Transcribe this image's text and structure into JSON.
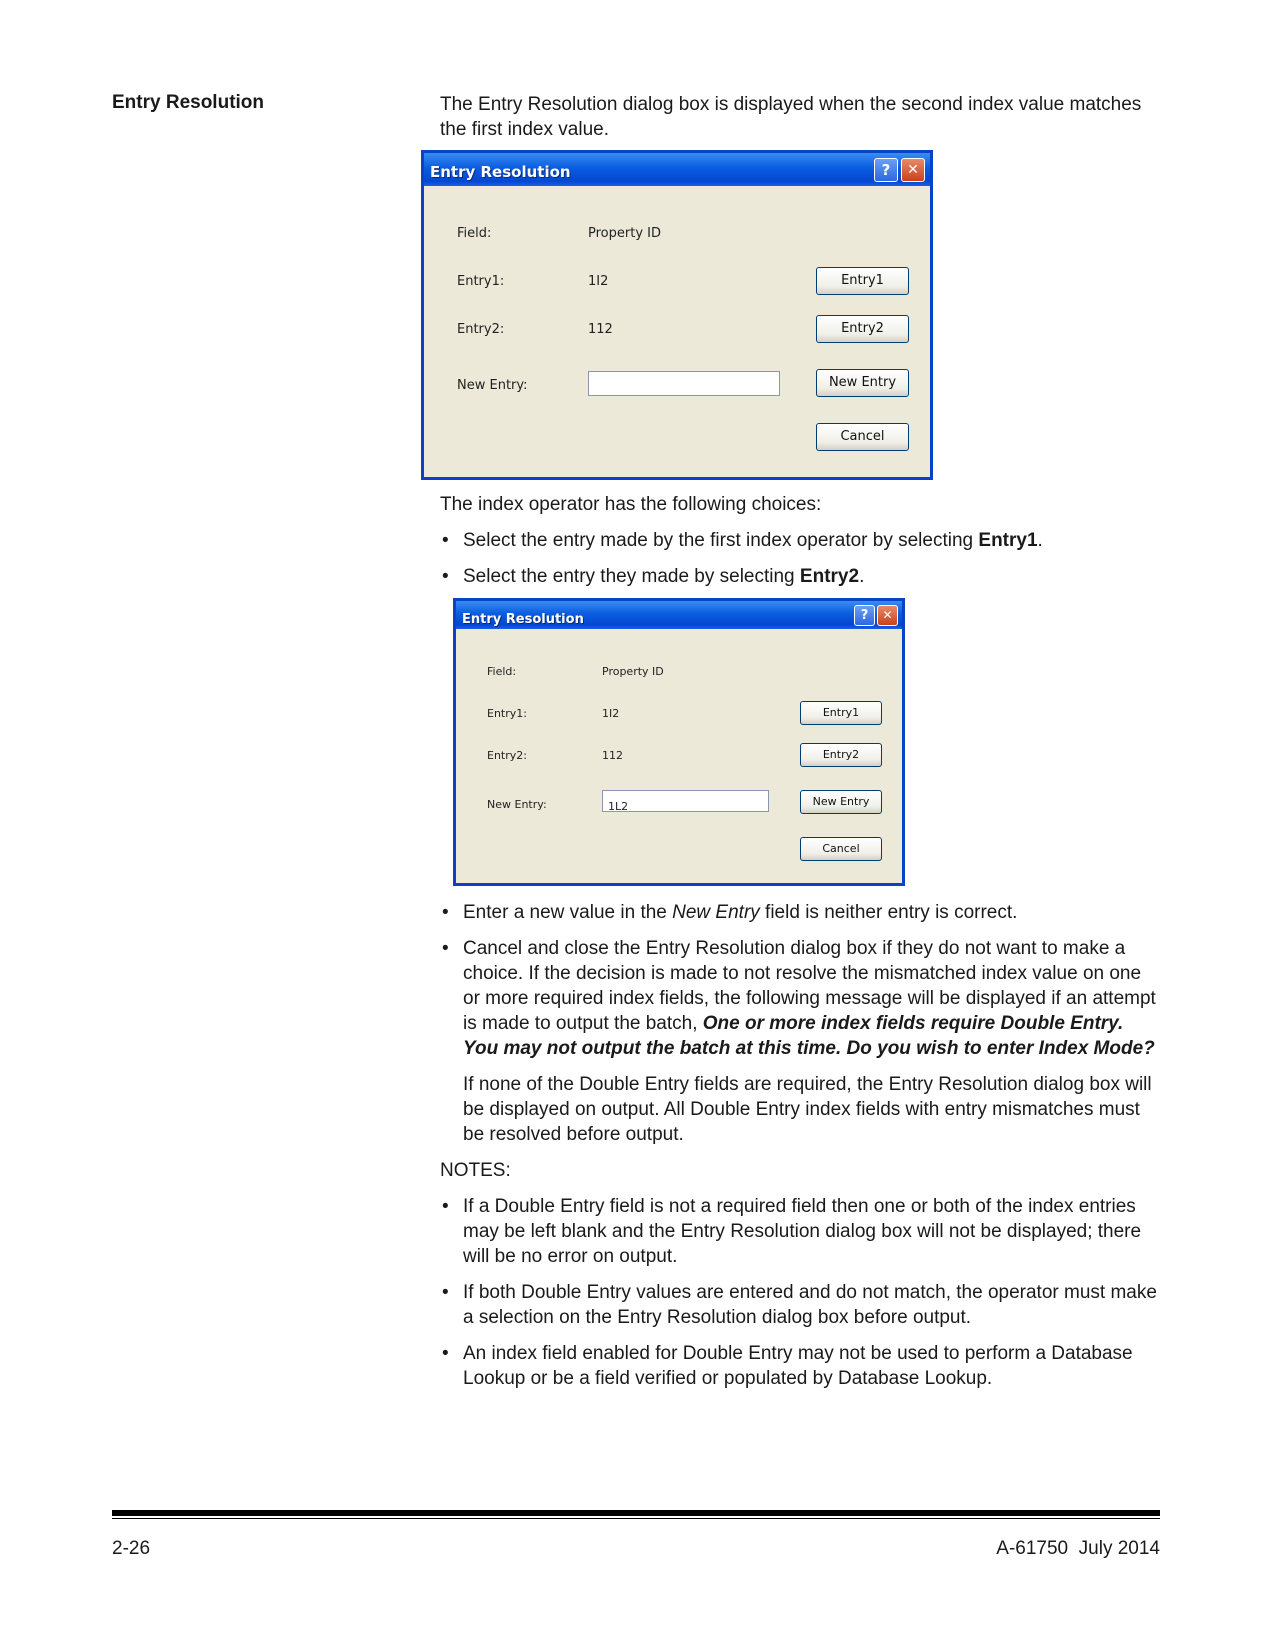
{
  "heading": "Entry Resolution",
  "intro_text": "The Entry Resolution dialog box is displayed when the second index value matches the first index value.",
  "dialog1": {
    "title": "Entry Resolution",
    "help_glyph": "?",
    "close_glyph": "✕",
    "field_label": "Field:",
    "field_value": "Property ID",
    "entry1_label": "Entry1:",
    "entry1_value": "1I2",
    "entry2_label": "Entry2:",
    "entry2_value": "112",
    "new_entry_label": "New Entry:",
    "new_entry_value": "",
    "btn_entry1": "Entry1",
    "btn_entry2": "Entry2",
    "btn_new_entry": "New Entry",
    "btn_cancel": "Cancel"
  },
  "choices_intro": "The index operator has the following choices:",
  "bullet1": {
    "text": "Select the entry made by the first index operator by selecting ",
    "bold": "Entry1",
    "end": "."
  },
  "bullet2": {
    "text": "Select the entry they made by selecting ",
    "bold": "Entry2",
    "end": "."
  },
  "dialog2": {
    "title": "Entry Resolution",
    "help_glyph": "?",
    "close_glyph": "✕",
    "field_label": "Field:",
    "field_value": "Property ID",
    "entry1_label": "Entry1:",
    "entry1_value": "1I2",
    "entry2_label": "Entry2:",
    "entry2_value": "112",
    "new_entry_label": "New Entry:",
    "new_entry_value": "1L2",
    "btn_entry1": "Entry1",
    "btn_entry2": "Entry2",
    "btn_new_entry": "New Entry",
    "btn_cancel": "Cancel"
  },
  "bullet3": {
    "pre": "Enter a new value in the ",
    "italic": "New Entry",
    "post": " field is neither entry is correct."
  },
  "bullet4": {
    "pre": "Cancel and close the Entry Resolution dialog box if they do not want to make a choice. If the decision is made to not resolve the mismatched index value on one or more required index fields, the following message will be displayed if an attempt is made to output the batch, ",
    "bold_italic": "One or more index fields require Double Entry. You may not output the batch at this time. Do you wish to enter Index Mode?"
  },
  "bullet4_followup": "If none of the Double Entry fields are required, the Entry Resolution dialog box will be displayed on output. All Double Entry index fields with entry mismatches must be resolved before output.",
  "notes_heading": "NOTES:",
  "notes": [
    "If a Double Entry field is not a required field then one or both of the index entries may be left blank and the Entry Resolution dialog box will not be displayed; there will be no error on output.",
    "If both Double Entry values are entered and do not match, the operator must make a selection on the Entry Resolution dialog box before output.",
    "An index field enabled for Double Entry may not be used to perform a Database Lookup or be a field verified or populated by Database Lookup."
  ],
  "footer": {
    "page_number": "2-26",
    "doc_id": "A-61750  July 2014"
  }
}
